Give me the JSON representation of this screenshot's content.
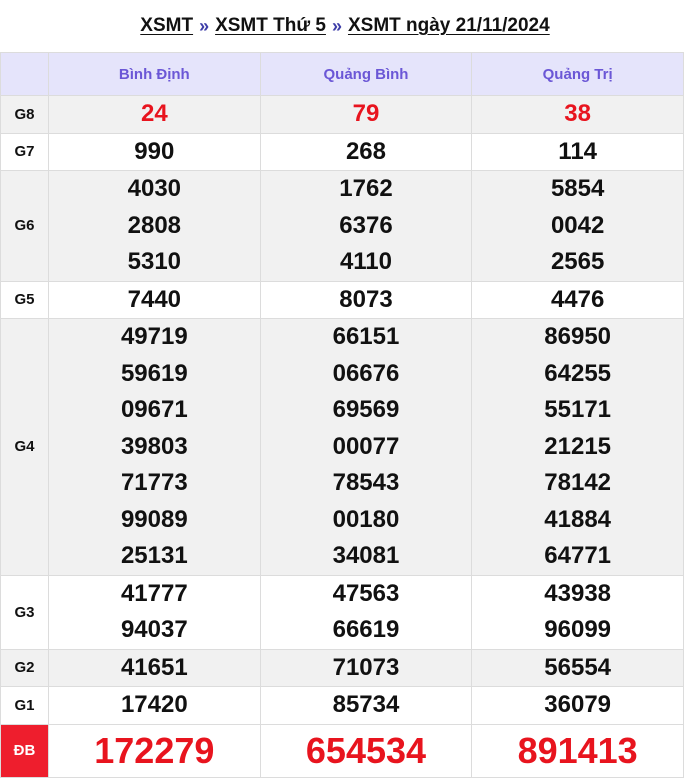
{
  "breadcrumb": {
    "items": [
      "XSMT",
      "XSMT Thứ 5",
      "XSMT ngày 21/11/2024"
    ],
    "separator": "»"
  },
  "table": {
    "provinces": [
      "Bình Định",
      "Quảng Bình",
      "Quảng Trị"
    ],
    "rows": [
      {
        "prize": "G8",
        "style": "grey",
        "highlight": true,
        "values": [
          [
            "24"
          ],
          [
            "79"
          ],
          [
            "38"
          ]
        ]
      },
      {
        "prize": "G7",
        "style": "white",
        "values": [
          [
            "990"
          ],
          [
            "268"
          ],
          [
            "114"
          ]
        ]
      },
      {
        "prize": "G6",
        "style": "grey",
        "values": [
          [
            "4030",
            "2808",
            "5310"
          ],
          [
            "1762",
            "6376",
            "4110"
          ],
          [
            "5854",
            "0042",
            "2565"
          ]
        ]
      },
      {
        "prize": "G5",
        "style": "white",
        "values": [
          [
            "7440"
          ],
          [
            "8073"
          ],
          [
            "4476"
          ]
        ]
      },
      {
        "prize": "G4",
        "style": "grey",
        "values": [
          [
            "49719",
            "59619",
            "09671",
            "39803",
            "71773",
            "99089",
            "25131"
          ],
          [
            "66151",
            "06676",
            "69569",
            "00077",
            "78543",
            "00180",
            "34081"
          ],
          [
            "86950",
            "64255",
            "55171",
            "21215",
            "78142",
            "41884",
            "64771"
          ]
        ]
      },
      {
        "prize": "G3",
        "style": "white",
        "values": [
          [
            "41777",
            "94037"
          ],
          [
            "47563",
            "66619"
          ],
          [
            "43938",
            "96099"
          ]
        ]
      },
      {
        "prize": "G2",
        "style": "grey",
        "values": [
          [
            "41651"
          ],
          [
            "71073"
          ],
          [
            "56554"
          ]
        ]
      },
      {
        "prize": "G1",
        "style": "white",
        "values": [
          [
            "17420"
          ],
          [
            "85734"
          ],
          [
            "36079"
          ]
        ]
      },
      {
        "prize": "ĐB",
        "style": "db",
        "highlight": true,
        "values": [
          [
            "172279"
          ],
          [
            "654534"
          ],
          [
            "891413"
          ]
        ]
      }
    ]
  },
  "colors": {
    "header_bg": "#e5e4fb",
    "header_text": "#6b57d6",
    "highlight_red": "#e8141e",
    "db_label_bg": "#ee1e2d",
    "row_grey": "#f1f1f1"
  }
}
